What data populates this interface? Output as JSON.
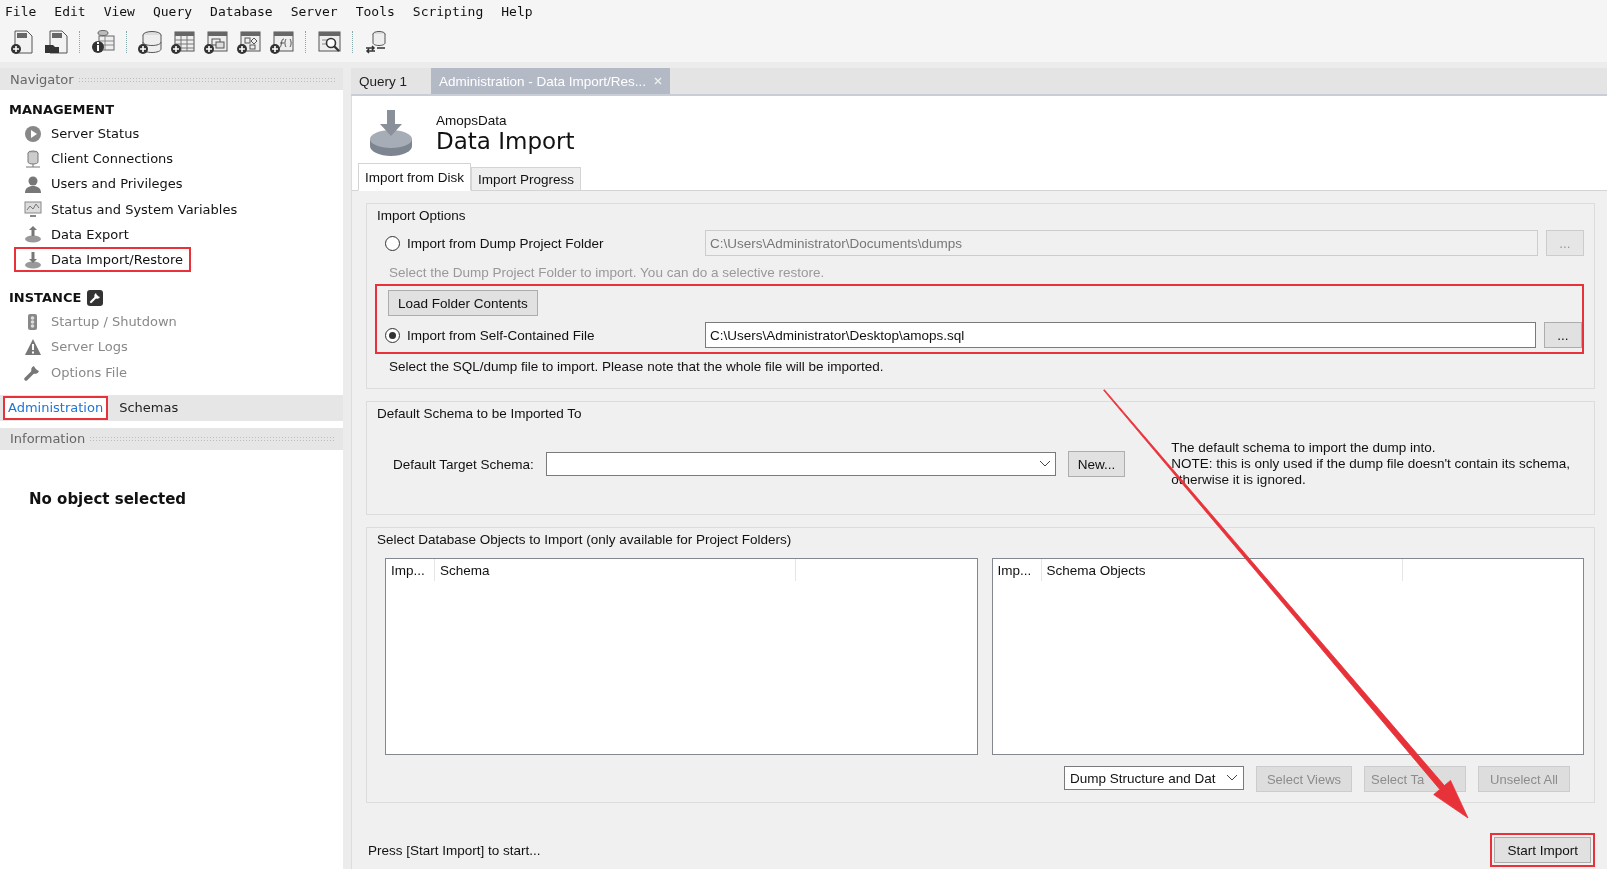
{
  "menu": [
    "File",
    "Edit",
    "View",
    "Query",
    "Database",
    "Server",
    "Tools",
    "Scripting",
    "Help"
  ],
  "navigator": {
    "title": "Navigator",
    "sections": [
      {
        "title": "MANAGEMENT",
        "items": [
          {
            "label": "Server Status",
            "disabled": false,
            "highlighted": false
          },
          {
            "label": "Client Connections",
            "disabled": false,
            "highlighted": false
          },
          {
            "label": "Users and Privileges",
            "disabled": false,
            "highlighted": false
          },
          {
            "label": "Status and System Variables",
            "disabled": false,
            "highlighted": false
          },
          {
            "label": "Data Export",
            "disabled": false,
            "highlighted": false
          },
          {
            "label": "Data Import/Restore",
            "disabled": false,
            "highlighted": true
          }
        ]
      },
      {
        "title": "INSTANCE",
        "items": [
          {
            "label": "Startup / Shutdown",
            "disabled": true,
            "highlighted": false
          },
          {
            "label": "Server Logs",
            "disabled": true,
            "highlighted": false
          },
          {
            "label": "Options File",
            "disabled": true,
            "highlighted": false
          }
        ]
      }
    ]
  },
  "navigator_tabs": [
    {
      "label": "Administration",
      "selected": true,
      "highlighted": true
    },
    {
      "label": "Schemas",
      "selected": false,
      "highlighted": false
    }
  ],
  "information": {
    "title": "Information",
    "message": "No object selected"
  },
  "editor_tabs": [
    {
      "label": "Query 1",
      "selected": false,
      "closable": false
    },
    {
      "label": "Administration - Data Import/Res...",
      "selected": true,
      "closable": true
    }
  ],
  "header": {
    "connection": "AmopsData",
    "title": "Data Import"
  },
  "subtabs": [
    {
      "label": "Import from Disk",
      "selected": true
    },
    {
      "label": "Import Progress",
      "selected": false
    }
  ],
  "import_options": {
    "title": "Import Options",
    "folder_option": {
      "label": "Import from Dump Project Folder",
      "selected": false,
      "path": "C:\\Users\\Administrator\\Documents\\dumps",
      "disabled": true,
      "browse": "..."
    },
    "folder_hint": "Select the Dump Project Folder to import. You can do a selective restore.",
    "load_button": "Load Folder Contents",
    "file_option": {
      "label": "Import from Self-Contained File",
      "selected": true,
      "path": "C:\\Users\\Administrator\\Desktop\\amops.sql",
      "disabled": false,
      "browse": "..."
    },
    "highlighted": true,
    "file_hint": "Select the SQL/dump file to import. Please note that the whole file will be imported."
  },
  "default_schema": {
    "title": "Default Schema to be Imported To",
    "label": "Default Target Schema:",
    "new_button": "New...",
    "note": "The default schema to import the dump into.\nNOTE: this is only used if the dump file doesn't contain its schema,\notherwise it is ignored."
  },
  "objects": {
    "title": "Select Database Objects to Import (only available for Project Folders)",
    "tables": [
      {
        "columns": [
          "Imp...",
          "Schema"
        ]
      },
      {
        "columns": [
          "Imp...",
          "Schema Objects"
        ]
      }
    ],
    "dump_mode": "Dump Structure and Dat",
    "buttons": [
      {
        "label": "Select Views",
        "disabled": true
      },
      {
        "label": "Select Ta",
        "disabled": true
      },
      {
        "label": "Unselect All",
        "disabled": true
      }
    ]
  },
  "status": "Press [Start Import] to start...",
  "start_button": {
    "label": "Start Import",
    "highlighted": true
  }
}
